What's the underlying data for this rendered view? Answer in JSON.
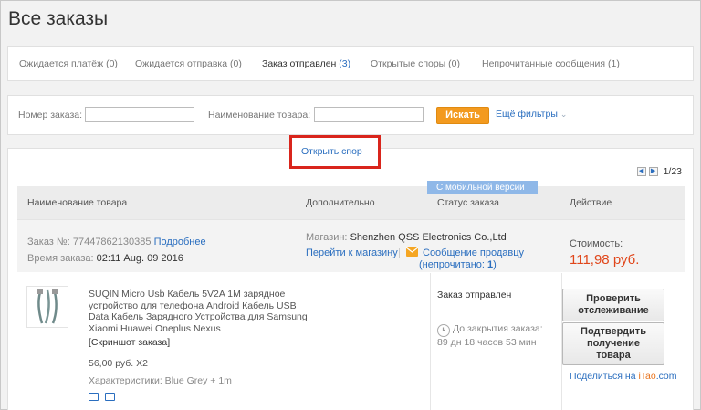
{
  "page": {
    "title": "Все заказы"
  },
  "tabs": [
    {
      "label": "Ожидается платёж",
      "count": "(0)"
    },
    {
      "label": "Ожидается отправка",
      "count": "(0)"
    },
    {
      "label": "Заказ отправлен",
      "count": "(3)"
    },
    {
      "label": "Открытые споры",
      "count": "(0)"
    },
    {
      "label": "Непрочитанные сообщения",
      "count": "(1)"
    }
  ],
  "search": {
    "order_label": "Номер заказа:",
    "order_value": "",
    "product_label": "Наименование товара:",
    "product_value": "",
    "button": "Искать",
    "more_filters": "Ещё фильтры"
  },
  "pager": {
    "text": "1/23"
  },
  "columns": [
    "Наименование товара",
    "Дополнительно",
    "Статус заказа",
    "Действие"
  ],
  "order": {
    "number_label": "Заказ №:",
    "number": "77447862130385",
    "details_link": "Подробнее",
    "time_label": "Время заказа:",
    "time": "02:11 Aug. 09 2016",
    "store_label": "Магазин:",
    "store": "Shenzhen QSS Electronics Co.,Ltd",
    "store_link": "Перейти к магазину",
    "message_link": "Сообщение продавцу",
    "unread_prefix": "(непрочитано: ",
    "unread_count": "1",
    "unread_suffix": ")",
    "cost_label": "Стоимость:",
    "cost": "111,98 руб."
  },
  "product": {
    "name_lines": [
      "SUQIN Micro Usb Кабель 5V2A 1M зарядное",
      "устройство для телефона Android Кабель USB",
      "Data Кабель Зарядного Устройства для Samsung",
      "Xiaomi Huawei Oneplus Nexus"
    ],
    "snapshot": "[Скриншот заказа]",
    "price": "56,00 руб. X2",
    "attributes": "Характеристики: Blue Grey + 1m"
  },
  "extra": {
    "open_dispute": "Открыть спор"
  },
  "status": {
    "text": "Заказ отправлен",
    "mobile_badge": "С мобильной версии",
    "closing_line1": "До закрытия заказа:",
    "closing_line2": "89 дн 18 часов 53 мин"
  },
  "actions": {
    "track_line1": "Проверить",
    "track_line2": "отслеживание",
    "confirm_line1": "Подтвердить",
    "confirm_line2": "получение",
    "confirm_line3": "товара",
    "share_prefix": "Поделиться на ",
    "share_site_a": "iTao",
    "share_site_b": ".com"
  },
  "colors": {
    "accent": "#f39a1f",
    "link": "#2a6ebf",
    "price": "#e0461a",
    "highlight": "#d9251c"
  }
}
